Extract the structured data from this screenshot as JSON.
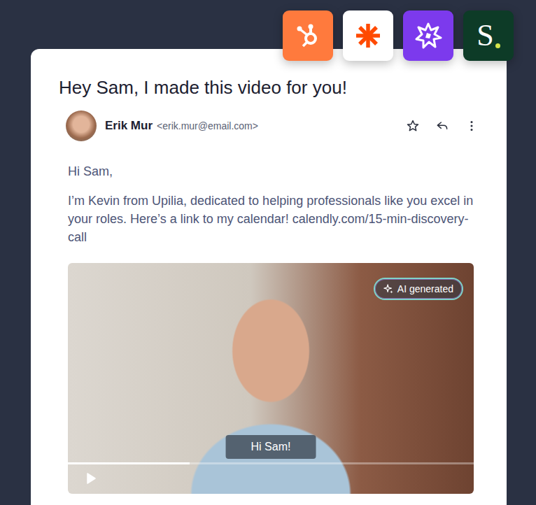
{
  "integrations": [
    {
      "kind": "hubspot",
      "color": "#ff7a3d"
    },
    {
      "kind": "zapier",
      "color": "#ffffff"
    },
    {
      "kind": "spark",
      "color": "#7c3aed"
    },
    {
      "kind": "letter",
      "text": "S",
      "color": "#0d3b27"
    }
  ],
  "email": {
    "subject": "Hey Sam, I made this video for you!",
    "sender": {
      "name": "Erik Mur",
      "address": "<erik.mur@email.com>"
    },
    "greeting": "Hi Sam,",
    "body": "I’m Kevin from Upilia, dedicated to helping professionals like you excel in your roles. Here’s a link to my calendar! calendly.com/15-min-discovery-call",
    "video": {
      "badge": "AI generated",
      "caption": "Hi Sam!",
      "level": 0.3,
      "playing": false
    }
  }
}
